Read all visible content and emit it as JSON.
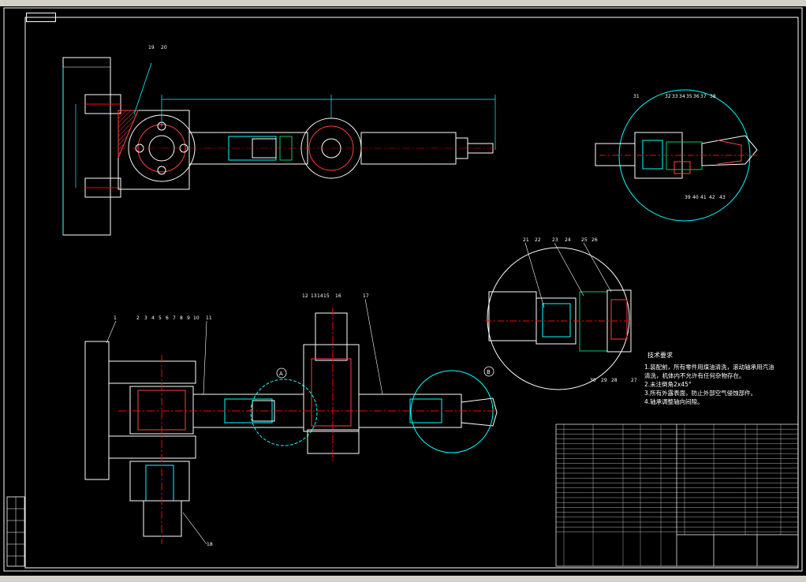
{
  "tech_requirements": {
    "title": "技术要求",
    "lines": [
      "1.装配前，所有零件用煤油清洗，滚动轴承用汽油",
      "清洗，机体内不允许有任何杂物存在。",
      "2.未注倒角2x45°",
      "3.所有外露表面，防止外部空气侵蚀部件。",
      "4.轴承调整轴向间隙。"
    ]
  },
  "callouts": {
    "top": [
      "19",
      "20"
    ],
    "bottom": [
      "1",
      "2",
      "3",
      "4",
      "5",
      "6",
      "7",
      "8",
      "9",
      "10",
      "11",
      "12",
      "13",
      "14",
      "15",
      "16",
      "17",
      "18"
    ],
    "detail_a": [
      "21",
      "22",
      "23",
      "24",
      "25",
      "26",
      "27",
      "28",
      "29",
      "30"
    ],
    "detail_b": [
      "31",
      "32",
      "33",
      "34",
      "35",
      "36",
      "37",
      "38",
      "39",
      "40",
      "41",
      "42",
      "43"
    ],
    "circle_a": "A",
    "circle_b": "B"
  },
  "colors": {
    "outline": "#00ffff",
    "part": "#ffffff",
    "center": "#ff0000",
    "hatch": "#ff4040",
    "accent": "#00cc66",
    "yellow": "#ffff00",
    "background": "#000000"
  }
}
